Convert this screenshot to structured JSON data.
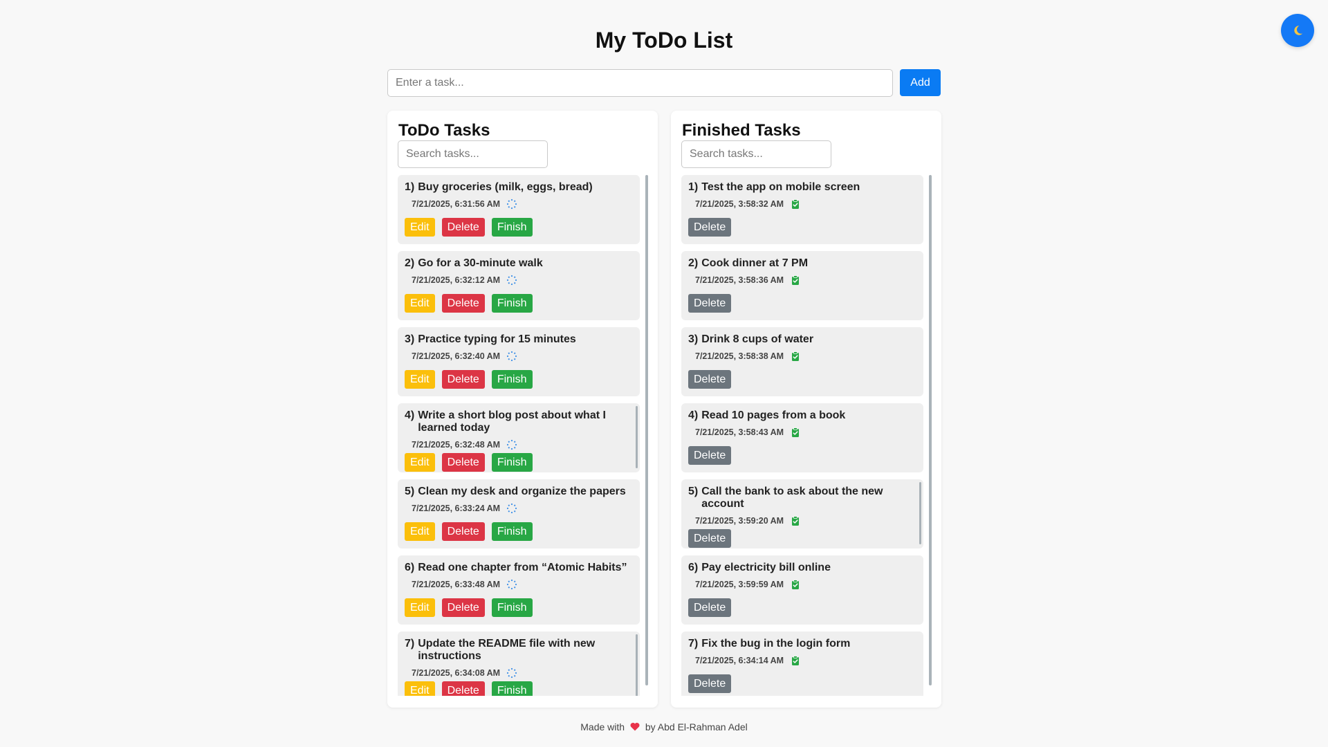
{
  "header": {
    "title": "My ToDo List"
  },
  "theme_toggle": {
    "icon": "moon-icon",
    "color": "#1479f6"
  },
  "add_form": {
    "placeholder": "Enter a task...",
    "add_label": "Add"
  },
  "todo_panel": {
    "title": "ToDo Tasks",
    "search_placeholder": "Search tasks...",
    "status_icon": "spinner-icon",
    "buttons": {
      "edit": "Edit",
      "delete": "Delete",
      "finish": "Finish"
    },
    "tasks": [
      {
        "num": "1)",
        "text": "Buy groceries (milk, eggs, bread)",
        "time": "7/21/2025, 6:31:56 AM"
      },
      {
        "num": "2)",
        "text": "Go for a 30-minute walk",
        "time": "7/21/2025, 6:32:12 AM"
      },
      {
        "num": "3)",
        "text": "Practice typing for 15 minutes",
        "time": "7/21/2025, 6:32:40 AM"
      },
      {
        "num": "4)",
        "text": "Write a short blog post about what I learned today",
        "time": "7/21/2025, 6:32:48 AM"
      },
      {
        "num": "5)",
        "text": "Clean my desk and organize the papers",
        "time": "7/21/2025, 6:33:24 AM"
      },
      {
        "num": "6)",
        "text": "Read one chapter from “Atomic Habits”",
        "time": "7/21/2025, 6:33:48 AM"
      },
      {
        "num": "7)",
        "text": "Update the README file with new instructions",
        "time": "7/21/2025, 6:34:08 AM"
      }
    ]
  },
  "finished_panel": {
    "title": "Finished Tasks",
    "search_placeholder": "Search tasks...",
    "status_icon": "clipboard-check-icon",
    "buttons": {
      "delete": "Delete"
    },
    "tasks": [
      {
        "num": "1)",
        "text": "Test the app on mobile screen",
        "time": "7/21/2025, 3:58:32 AM"
      },
      {
        "num": "2)",
        "text": "Cook dinner at 7 PM",
        "time": "7/21/2025, 3:58:36 AM"
      },
      {
        "num": "3)",
        "text": "Drink 8 cups of water",
        "time": "7/21/2025, 3:58:38 AM"
      },
      {
        "num": "4)",
        "text": "Read 10 pages from a book",
        "time": "7/21/2025, 3:58:43 AM"
      },
      {
        "num": "5)",
        "text": "Call the bank to ask about the new account",
        "time": "7/21/2025, 3:59:20 AM"
      },
      {
        "num": "6)",
        "text": "Pay electricity bill online",
        "time": "7/21/2025, 3:59:59 AM"
      },
      {
        "num": "7)",
        "text": "Fix the bug in the login form",
        "time": "7/21/2025, 6:34:14 AM"
      }
    ]
  },
  "footer": {
    "prefix": "Made with",
    "icon": "heart-icon",
    "suffix": "by Abd El-Rahman Adel"
  },
  "colors": {
    "accent": "#0a7bf3",
    "edit": "#fbbf0b",
    "delete": "#dc3545",
    "finish": "#28a745",
    "finished_delete": "#6c757d",
    "heart": "#e8334a"
  }
}
